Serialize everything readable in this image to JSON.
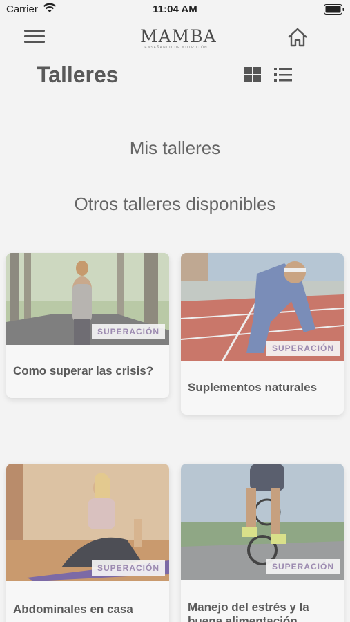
{
  "status_bar": {
    "carrier": "Carrier",
    "time": "11:04 AM"
  },
  "nav": {
    "logo_text": "MAMBA",
    "logo_tagline": "ENSEÑANDO DE NUTRICIÓN",
    "menu_icon": "hamburger-menu-icon",
    "home_icon": "home-icon"
  },
  "header": {
    "title": "Talleres",
    "grid_view_icon": "grid-view-icon",
    "list_view_icon": "list-view-icon"
  },
  "sections": {
    "mine": "Mis talleres",
    "others": "Otros talleres disponibles"
  },
  "workshops": [
    {
      "title": "Como superar las crisis?",
      "category": "SUPERACIÓN"
    },
    {
      "title": "Suplementos naturales",
      "category": "SUPERACIÓN"
    },
    {
      "title": "Abdominales en casa",
      "category": "SUPERACIÓN"
    },
    {
      "title": "Manejo del estrés y la buena alimentación",
      "category": "SUPERACIÓN"
    }
  ],
  "colors": {
    "background": "#f3f3f3",
    "text": "#595959",
    "badge_text": "#9c8ab0"
  }
}
